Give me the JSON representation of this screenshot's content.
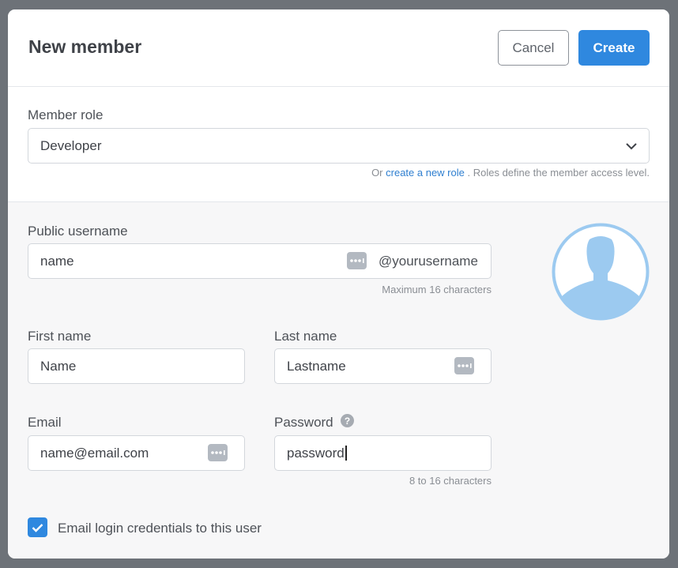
{
  "header": {
    "title": "New member",
    "cancel_label": "Cancel",
    "create_label": "Create"
  },
  "role": {
    "label": "Member role",
    "selected": "Developer",
    "hint_prefix": "Or",
    "hint_link": "create a new role",
    "hint_suffix": ". Roles define the member access level."
  },
  "username": {
    "label": "Public username",
    "value": "name",
    "suffix": "@yourusername",
    "hint": "Maximum 16 characters"
  },
  "first_name": {
    "label": "First name",
    "value": "Name"
  },
  "last_name": {
    "label": "Last name",
    "value": "Lastname"
  },
  "email": {
    "label": "Email",
    "value": "name@email.com"
  },
  "password": {
    "label": "Password",
    "value": "password",
    "hint": "8 to 16 characters",
    "help_glyph": "?"
  },
  "email_credentials": {
    "label": "Email login credentials to this user",
    "checked": true
  },
  "colors": {
    "primary": "#2f88df",
    "avatar": "#9ccaf0"
  },
  "icons": [
    "chevron-down-icon",
    "dots-icon",
    "help-icon",
    "check-icon",
    "avatar-icon"
  ]
}
